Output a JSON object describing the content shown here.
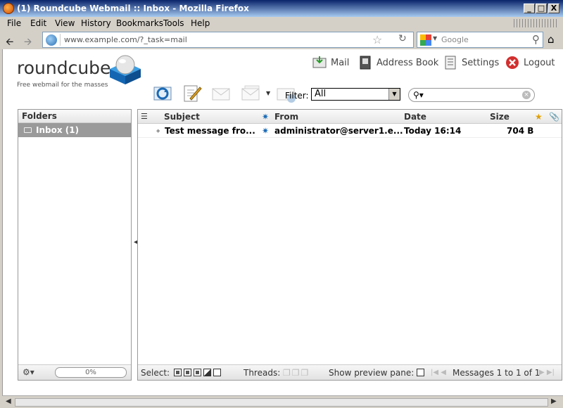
{
  "window": {
    "title": "(1) Roundcube Webmail :: Inbox - Mozilla Firefox",
    "minimize": "_",
    "maximize": "□",
    "close": "X"
  },
  "menu": {
    "items": [
      "File",
      "Edit",
      "View",
      "History",
      "Bookmarks",
      "Tools",
      "Help"
    ]
  },
  "browser": {
    "url": "www.example.com/?_task=mail",
    "search_placeholder": "Google"
  },
  "app": {
    "logo_text": "roundcube",
    "tagline": "Free webmail for the masses",
    "nav": {
      "mail": "Mail",
      "addressbook": "Address Book",
      "settings": "Settings",
      "logout": "Logout"
    },
    "filter_label": "Filter:",
    "filter_value": "All",
    "folders": {
      "header": "Folders",
      "inbox": "Inbox (1)",
      "quota": "0%"
    },
    "list": {
      "columns": {
        "subject": "Subject",
        "from": "From",
        "date": "Date",
        "size": "Size"
      },
      "rows": [
        {
          "subject": "Test message fro...",
          "from": "administrator@server1.e...",
          "date": "Today 16:14",
          "size": "704 B"
        }
      ],
      "footer": {
        "select": "Select:",
        "threads": "Threads:",
        "preview": "Show preview pane:",
        "count": "Messages 1 to 1 of 1"
      }
    }
  },
  "colors": {
    "title_start": "#0a246a",
    "title_end": "#a6caf0",
    "logout": "#d32f2f",
    "selected_folder": "#9a9a9a"
  }
}
